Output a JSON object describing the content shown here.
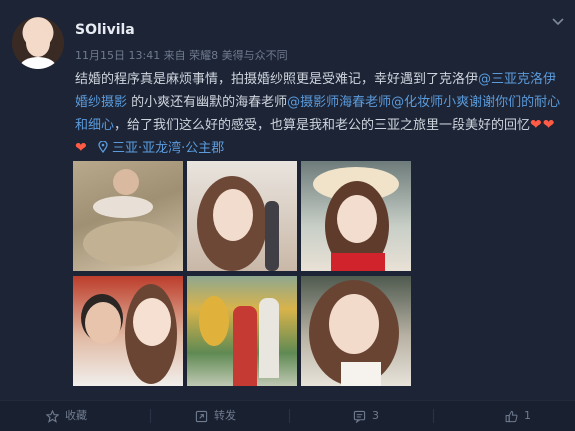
{
  "post": {
    "username": "SOlivila",
    "meta": "11月15日 13:41 来自 荣耀8 美得与众不同",
    "text": {
      "t1": "结婚的程序真是麻烦事情，拍摄婚纱照更是受难记，幸好遇到了克洛伊",
      "l1": "@三亚克洛伊婚纱摄影",
      "t2": " 的小爽还有幽默的海春老师",
      "l2": "@摄影师海春老师",
      "l3": "@化妆师小爽谢谢你们的耐心和细心",
      "t3": "，给了我们这么好的感受，也算是我和老公的三亚之旅里一段美好的回忆",
      "hearts": "❤❤❤",
      "location": "三亚·亚龙湾·公主郡"
    }
  },
  "actions": {
    "favorite": "收藏",
    "repost": "转发",
    "comments": "3",
    "likes": "1"
  },
  "colors": {
    "background": "#1c2435",
    "link": "#5b9bdc",
    "muted": "#6f7b8f",
    "heart": "#ff5b45"
  },
  "icons": [
    "star-icon",
    "repost-icon",
    "comment-icon",
    "like-icon",
    "location-pin-icon",
    "chevron-down-icon"
  ]
}
